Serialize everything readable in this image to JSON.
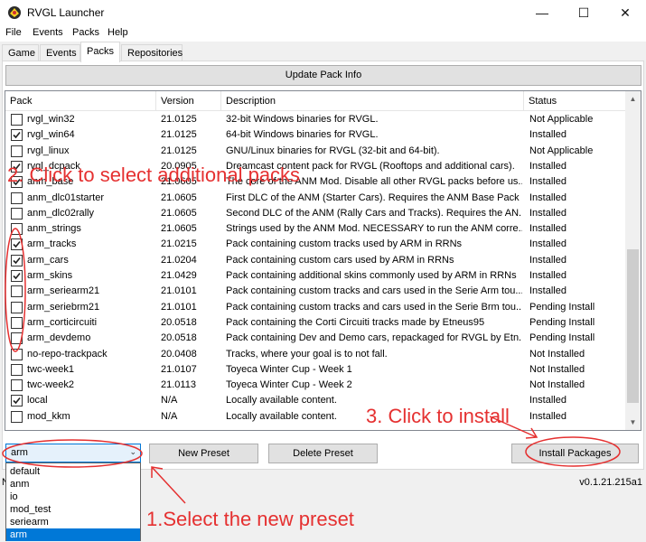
{
  "window": {
    "title": "RVGL Launcher",
    "minimize_glyph": "—",
    "maximize_glyph": "☐",
    "close_glyph": "✕",
    "icon": "rvgl-app-icon"
  },
  "menu": [
    "File",
    "Events",
    "Packs",
    "Help"
  ],
  "tabs": [
    "Game",
    "Events",
    "Packs",
    "Repositories"
  ],
  "active_tab": "Packs",
  "update_button": "Update Pack Info",
  "columns": [
    "Pack",
    "Version",
    "Description",
    "Status"
  ],
  "packs": [
    {
      "name": "rvgl_win32",
      "checked": false,
      "version": "21.0125",
      "description": "32-bit Windows binaries for RVGL.",
      "status": "Not Applicable"
    },
    {
      "name": "rvgl_win64",
      "checked": true,
      "version": "21.0125",
      "description": "64-bit Windows binaries for RVGL.",
      "status": "Installed"
    },
    {
      "name": "rvgl_linux",
      "checked": false,
      "version": "21.0125",
      "description": "GNU/Linux binaries for RVGL (32-bit and 64-bit).",
      "status": "Not Applicable"
    },
    {
      "name": "rvgl_dcpack",
      "checked": true,
      "version": "20.0905",
      "description": "Dreamcast content pack for RVGL (Rooftops and additional cars).",
      "status": "Installed"
    },
    {
      "name": "anm_base",
      "checked": true,
      "version": "21.0605",
      "description": "The core of the ANM Mod. Disable all other RVGL packs before us...",
      "status": "Installed"
    },
    {
      "name": "anm_dlc01starter",
      "checked": false,
      "version": "21.0605",
      "description": "First DLC of the ANM (Starter Cars). Requires the ANM Base Pack ...",
      "status": "Installed"
    },
    {
      "name": "anm_dlc02rally",
      "checked": false,
      "version": "21.0605",
      "description": "Second DLC of the ANM (Rally Cars and Tracks). Requires the AN...",
      "status": "Installed"
    },
    {
      "name": "anm_strings",
      "checked": false,
      "version": "21.0605",
      "description": "Strings used by the ANM Mod. NECESSARY to run the ANM corre...",
      "status": "Installed"
    },
    {
      "name": "arm_tracks",
      "checked": true,
      "version": "21.0215",
      "description": "Pack containing custom tracks used by ARM in RRNs",
      "status": "Installed"
    },
    {
      "name": "arm_cars",
      "checked": true,
      "version": "21.0204",
      "description": "Pack containing custom cars used by ARM in RRNs",
      "status": "Installed"
    },
    {
      "name": "arm_skins",
      "checked": true,
      "version": "21.0429",
      "description": "Pack containing additional skins commonly used by ARM in RRNs",
      "status": "Installed"
    },
    {
      "name": "arm_seriearm21",
      "checked": false,
      "version": "21.0101",
      "description": "Pack containing custom tracks and cars used in the Serie Arm tou...",
      "status": "Installed"
    },
    {
      "name": "arm_seriebrm21",
      "checked": false,
      "version": "21.0101",
      "description": "Pack containing custom tracks and cars used in the Serie Brm tou...",
      "status": "Pending Install"
    },
    {
      "name": "arm_corticircuiti",
      "checked": false,
      "version": "20.0518",
      "description": "Pack containing the Corti Circuiti tracks made by Etneus95",
      "status": "Pending Install"
    },
    {
      "name": "arm_devdemo",
      "checked": false,
      "version": "20.0518",
      "description": "Pack containing Dev and Demo cars, repackaged for RVGL by Etn...",
      "status": "Pending Install"
    },
    {
      "name": "no-repo-trackpack",
      "checked": false,
      "version": "20.0408",
      "description": "Tracks, where your goal is to not fall.",
      "status": "Not Installed"
    },
    {
      "name": "twc-week1",
      "checked": false,
      "version": "21.0107",
      "description": "Toyeca Winter Cup - Week 1",
      "status": "Not Installed"
    },
    {
      "name": "twc-week2",
      "checked": false,
      "version": "21.0113",
      "description": "Toyeca Winter Cup - Week 2",
      "status": "Not Installed"
    },
    {
      "name": "local",
      "checked": true,
      "version": "N/A",
      "description": "Locally available content.",
      "status": "Installed"
    },
    {
      "name": "mod_kkm",
      "checked": false,
      "version": "N/A",
      "description": "Locally available content.",
      "status": "Installed"
    }
  ],
  "preset_select": {
    "value": "arm",
    "options": [
      "default",
      "anm",
      "io",
      "mod_test",
      "seriearm",
      "arm"
    ],
    "selected": "arm"
  },
  "buttons": {
    "new_preset": "New Preset",
    "delete_preset": "Delete Preset",
    "install": "Install Packages"
  },
  "version_text": "v0.1.21.215a1",
  "status_left": "N",
  "annotations": {
    "step1": "1.Select the new preset",
    "step2": "2. Click to select additional packs",
    "step3": "3. Click to install"
  },
  "colors": {
    "annotation": "#e53030",
    "selection": "#0078d7",
    "button_face": "#e1e1e1"
  }
}
